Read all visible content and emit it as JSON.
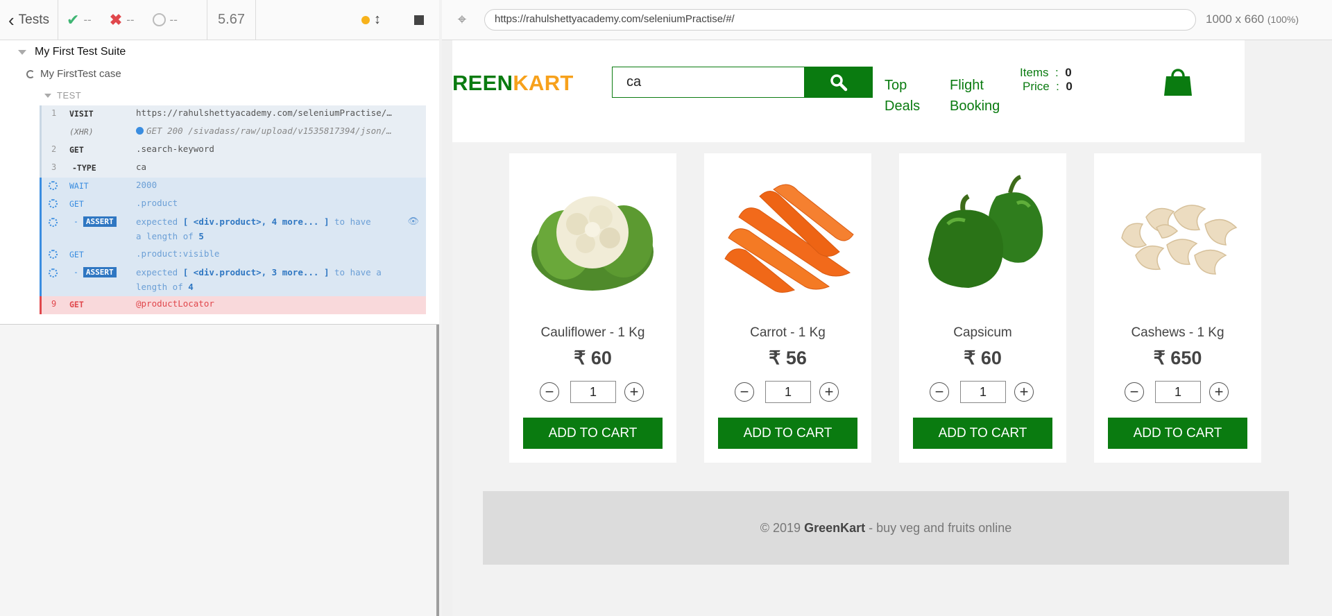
{
  "runner": {
    "back_label": "Tests",
    "passed": "--",
    "failed": "--",
    "pending": "--",
    "duration": "5.67",
    "suite_title": "My First Test Suite",
    "case_title": "My FirstTest case",
    "test_label": "TEST",
    "commands": [
      {
        "num": "1",
        "name": "VISIT",
        "message": "https://rahulshettyacademy.com/seleniumPractise/…"
      },
      {
        "num": "",
        "name": "(XHR)",
        "message": "GET 200 /sivadass/raw/upload/v1535817394/json/…"
      },
      {
        "num": "2",
        "name": "GET",
        "message": ".search-keyword"
      },
      {
        "num": "3",
        "name": "-TYPE",
        "message": "ca"
      },
      {
        "num": "",
        "name": "WAIT",
        "message": "2000"
      },
      {
        "num": "",
        "name": "GET",
        "message": ".product"
      },
      {
        "num": "",
        "name": "ASSERT",
        "msg_pre": "expected",
        "msg_subject": "[ <div.product>, 4 more... ]",
        "msg_mid": "to have",
        "msg_line2": "a length of",
        "msg_value": "5"
      },
      {
        "num": "",
        "name": "GET",
        "message": ".product:visible"
      },
      {
        "num": "",
        "name": "ASSERT",
        "msg_pre": "expected",
        "msg_subject": "[ <div.product>, 3 more... ]",
        "msg_mid": "to have a",
        "msg_line2": "length of",
        "msg_value": "4"
      },
      {
        "num": "9",
        "name": "GET",
        "message": "@productLocator"
      }
    ]
  },
  "preview": {
    "url": "https://rahulshettyacademy.com/seleniumPractise/#/",
    "viewport": "1000 x 660",
    "zoom": "(100%)"
  },
  "app": {
    "logo_green": "REEN",
    "logo_orange": "KART",
    "search_value": "ca",
    "nav": [
      {
        "line1": "Top",
        "line2": "Deals"
      },
      {
        "line1": "Flight",
        "line2": "Booking"
      }
    ],
    "items_label": "Items",
    "items_value": "0",
    "price_label": "Price",
    "price_value": "0",
    "add_label": "ADD TO CART",
    "products": [
      {
        "name": "Cauliflower - 1 Kg",
        "price": "₹ 60",
        "qty": "1",
        "image": "cauliflower"
      },
      {
        "name": "Carrot - 1 Kg",
        "price": "₹ 56",
        "qty": "1",
        "image": "carrot"
      },
      {
        "name": "Capsicum",
        "price": "₹ 60",
        "qty": "1",
        "image": "capsicum"
      },
      {
        "name": "Cashews - 1 Kg",
        "price": "₹ 650",
        "qty": "1",
        "image": "cashews"
      }
    ],
    "footer_pre": "© 2019",
    "footer_brand": "GreenKart",
    "footer_post": "- buy veg and fruits online"
  },
  "colors": {
    "brand_green": "#0a7b10",
    "brand_orange": "#f7a11b",
    "running_blue": "#3a8de0",
    "fail_red": "#e0474c"
  }
}
